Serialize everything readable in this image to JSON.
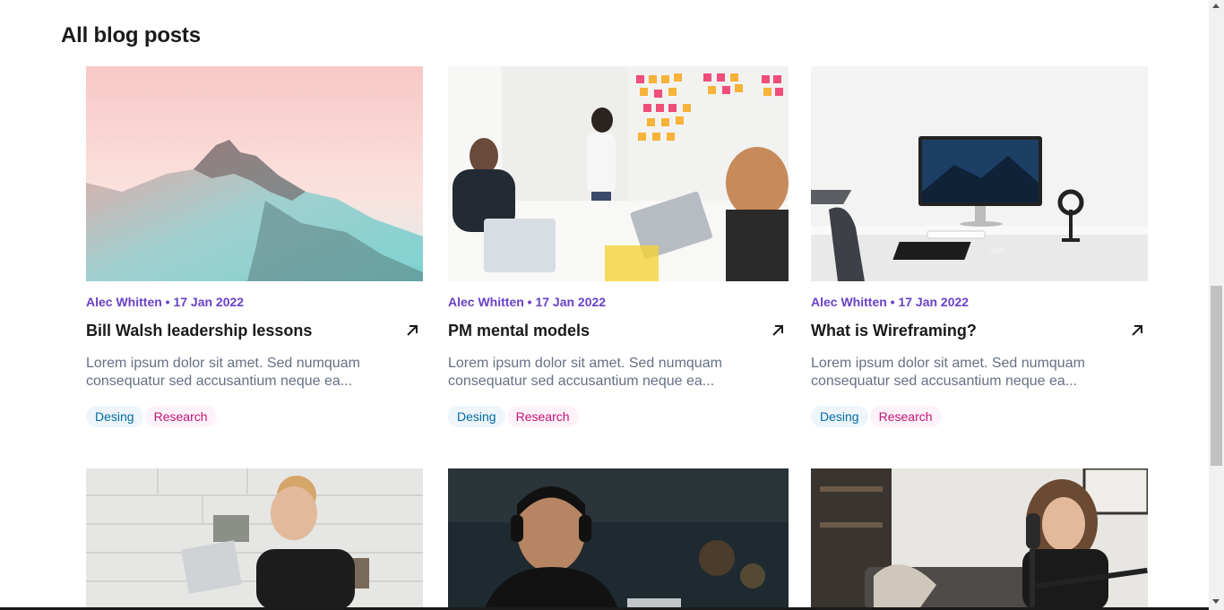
{
  "section": {
    "title": "All blog posts"
  },
  "posts": [
    {
      "meta": "Alec Whitten • 17 Jan 2022",
      "title": "Bill Walsh leadership lessons",
      "excerpt": "Lorem ipsum dolor sit amet. Sed numquam consequatur sed accusantium neque ea...",
      "tags": [
        "Desing",
        "Research"
      ]
    },
    {
      "meta": "Alec Whitten • 17 Jan 2022",
      "title": "PM mental models",
      "excerpt": "Lorem ipsum dolor sit amet. Sed numquam consequatur sed accusantium neque ea...",
      "tags": [
        "Desing",
        "Research"
      ]
    },
    {
      "meta": "Alec Whitten • 17 Jan 2022",
      "title": "What is Wireframing?",
      "excerpt": "Lorem ipsum dolor sit amet. Sed numquam consequatur sed accusantium neque ea...",
      "tags": [
        "Desing",
        "Research"
      ]
    }
  ],
  "colors": {
    "meta": "#6941c6",
    "tag_design_bg": "#eef6fb",
    "tag_design_text": "#026aa2",
    "tag_research_bg": "#fdf2fa",
    "tag_research_text": "#c11574"
  },
  "icons": {
    "card_link": "arrow-up-right-icon"
  }
}
